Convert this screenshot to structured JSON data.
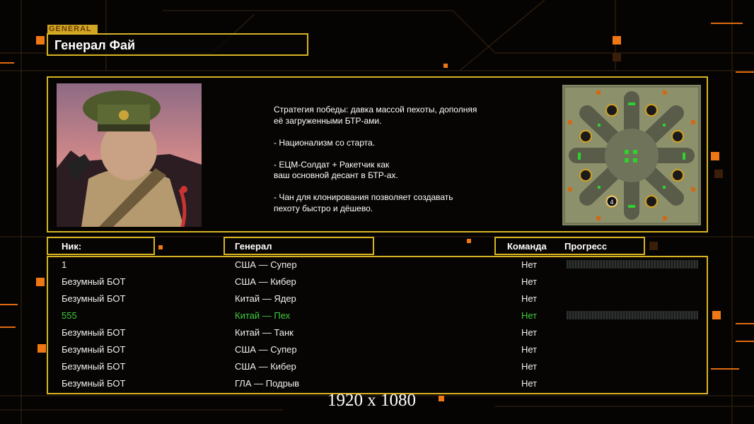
{
  "screen": {
    "general_tag": "GENERAL",
    "title": "Генерал Фай",
    "description": "Стратегия победы: давка массой пехоты, дополняя\n её загруженными БТР-ами.\n\n- Национализм со старта.\n\n- ЕЦМ-Солдат + Ракетчик как\nваш основной десант в БТР-ах.\n\n- Чан для клонирования позволяет создавать\n пехоту быстро и дёшево.",
    "map_player_count": "4",
    "resolution_caption": "1920 x 1080"
  },
  "table": {
    "headers": {
      "nick": "Ник:",
      "general": "Генерал",
      "team": "Команда",
      "progress": "Прогресс"
    },
    "rows": [
      {
        "nick": "1",
        "general": "США — Супер",
        "team": "Нет",
        "progress_bar": true,
        "highlight": false
      },
      {
        "nick": "Безумный БОТ",
        "general": "США — Кибер",
        "team": "Нет",
        "progress_bar": false,
        "highlight": false
      },
      {
        "nick": "Безумный БОТ",
        "general": "Китай — Ядер",
        "team": "Нет",
        "progress_bar": false,
        "highlight": false
      },
      {
        "nick": "555",
        "general": "Китай — Пех",
        "team": "Нет",
        "progress_bar": true,
        "highlight": true
      },
      {
        "nick": "Безумный БОТ",
        "general": "Китай — Танк",
        "team": "Нет",
        "progress_bar": false,
        "highlight": false
      },
      {
        "nick": "Безумный БОТ",
        "general": "США — Супер",
        "team": "Нет",
        "progress_bar": false,
        "highlight": false
      },
      {
        "nick": "Безумный БОТ",
        "general": "США — Кибер",
        "team": "Нет",
        "progress_bar": false,
        "highlight": false
      },
      {
        "nick": "Безумный БОТ",
        "general": "ГЛА — Подрыв",
        "team": "Нет",
        "progress_bar": false,
        "highlight": false
      }
    ]
  },
  "colors": {
    "frame": "#d7b323",
    "highlight_row": "#3fcc3f",
    "accent_orange": "#f07814"
  }
}
